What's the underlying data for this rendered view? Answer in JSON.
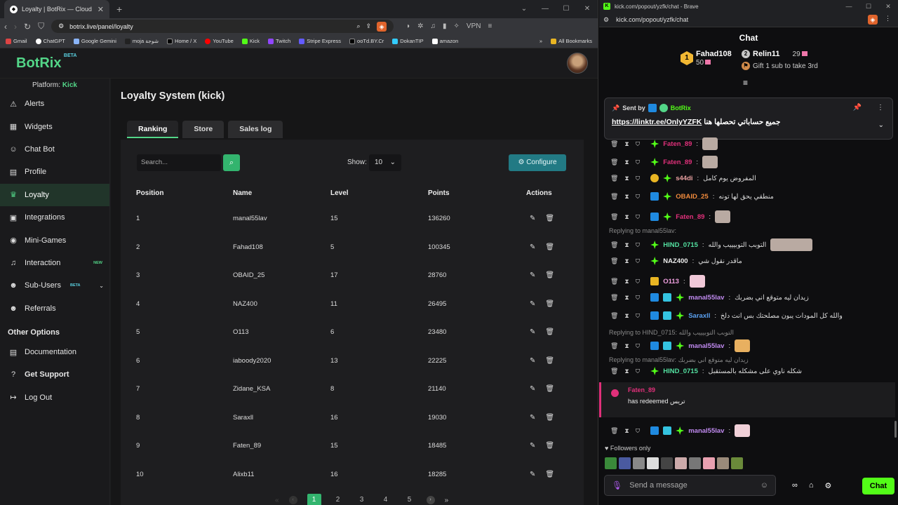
{
  "left_browser": {
    "tab_title": "Loyalty | BotRix — Cloud Strea...",
    "tab_close": "✕",
    "new_tab": "+",
    "url": "botrix.live/panel/loyalty",
    "vpn": "VPN",
    "bookmarks": [
      "Gmail",
      "ChatGPT",
      "Google Gemini",
      "moja شوجة",
      "Home / X",
      "YouTube",
      "Kick",
      "Twitch",
      "Stripe Express",
      "ooTd.BY.Cr",
      "DokanTIP",
      "amazon"
    ],
    "all_bookmarks": "All Bookmarks"
  },
  "botrix": {
    "logo": "BotRix",
    "logo_beta": "BETA",
    "platform_label": "Platform:",
    "platform_value": "Kick",
    "sidebar": [
      {
        "label": "Alerts",
        "icon": "⚠"
      },
      {
        "label": "Widgets",
        "icon": "▦"
      },
      {
        "label": "Chat Bot",
        "icon": "☺"
      },
      {
        "label": "Profile",
        "icon": "▤"
      },
      {
        "label": "Loyalty",
        "icon": "♛"
      },
      {
        "label": "Integrations",
        "icon": "▣"
      },
      {
        "label": "Mini-Games",
        "icon": "◉"
      },
      {
        "label": "Interaction",
        "icon": "♫",
        "badge": "NEW"
      },
      {
        "label": "Sub-Users",
        "icon": "☻",
        "badge": "BETA"
      },
      {
        "label": "Referrals",
        "icon": "☻"
      }
    ],
    "other_options_title": "Other Options",
    "other_options": [
      {
        "label": "Documentation",
        "icon": "▤"
      },
      {
        "label": "Get Support",
        "icon": "?"
      },
      {
        "label": "Log Out",
        "icon": "↦"
      }
    ],
    "page_title": "Loyalty System (kick)",
    "tabs": [
      "Ranking",
      "Store",
      "Sales log"
    ],
    "search_placeholder": "Search...",
    "show_label": "Show:",
    "show_value": "10",
    "configure": "Configure",
    "columns": [
      "Position",
      "Name",
      "Level",
      "Points",
      "Actions"
    ],
    "rows": [
      {
        "position": "1",
        "name": "manal55lav",
        "level": "15",
        "points": "136260"
      },
      {
        "position": "2",
        "name": "Fahad108",
        "level": "5",
        "points": "100345"
      },
      {
        "position": "3",
        "name": "OBAID_25",
        "level": "17",
        "points": "28760"
      },
      {
        "position": "4",
        "name": "NAZ400",
        "level": "11",
        "points": "26495"
      },
      {
        "position": "5",
        "name": "O113",
        "level": "6",
        "points": "23480"
      },
      {
        "position": "6",
        "name": "iaboody2020",
        "level": "13",
        "points": "22225"
      },
      {
        "position": "7",
        "name": "Zidane_KSA",
        "level": "8",
        "points": "21140"
      },
      {
        "position": "8",
        "name": "Saraxll",
        "level": "16",
        "points": "19030"
      },
      {
        "position": "9",
        "name": "Faten_89",
        "level": "15",
        "points": "18485"
      },
      {
        "position": "10",
        "name": "Alixb11",
        "level": "16",
        "points": "18285"
      }
    ],
    "pages": [
      "1",
      "2",
      "3",
      "4",
      "5"
    ]
  },
  "right_browser": {
    "title": "kick.com/popout/yzfk/chat - Brave",
    "url": "kick.com/popout/yzfk/chat"
  },
  "chat": {
    "header": "Chat",
    "top1_name": "Fahad108",
    "top1_count": "50",
    "top2_name": "Relin11",
    "top2_count": "29",
    "top3_text": "Gift 1 sub to take 3rd",
    "pinned_sent_by": "Sent by",
    "pinned_author": "BotRix",
    "pinned_text": "جميع حساباتي تحصلها هنا",
    "pinned_link": "https://linktr.ee/OnlyYZFK",
    "messages": [
      {
        "user": "Faten_89",
        "color": "#e0307a",
        "text": ""
      },
      {
        "user": "Faten_89",
        "color": "#e0307a",
        "text": ""
      },
      {
        "user": "s44di",
        "color": "#e8a0a0",
        "text": "المفروض يوم كامل"
      },
      {
        "user": "OBAID_25",
        "color": "#f08a3c",
        "text": "منطقي يحق لها تونه"
      },
      {
        "user": "Faten_89",
        "color": "#e0307a",
        "text": ""
      },
      {
        "user": "HIND_0715",
        "color": "#53e0a0",
        "text": "التوبب التوبيييب والله"
      },
      {
        "user": "NAZ400",
        "color": "#eee",
        "text": "ماقدر نقول شي"
      },
      {
        "user": "O113",
        "color": "#f0a0e0",
        "text": ""
      },
      {
        "user": "manal55lav",
        "color": "#c08af0",
        "text": "زيدان ليه متوقع اني بضربك"
      },
      {
        "user": "Saraxll",
        "color": "#5aa0f0",
        "text": "والله كل المودات يبون مصلحتك بس انت دلخ"
      },
      {
        "user": "manal55lav",
        "color": "#c08af0",
        "text": ""
      },
      {
        "user": "HIND_0715",
        "color": "#53e0a0",
        "text": "شكله ناوي على مشكله بالمستقبل"
      },
      {
        "user": "manal55lav",
        "color": "#c08af0",
        "text": ""
      }
    ],
    "replies": [
      "Replying to manal55lav:",
      "Replying to HIND_0715: التوبب التوبيييب والله",
      "Replying to manal55lav: زيدان ليه متوقع اني بضربك"
    ],
    "redeem_user": "Faten_89",
    "redeem_text": "has redeemed تريس",
    "followers_only": "Followers only",
    "input_placeholder": "Send a message",
    "send": "Chat"
  }
}
